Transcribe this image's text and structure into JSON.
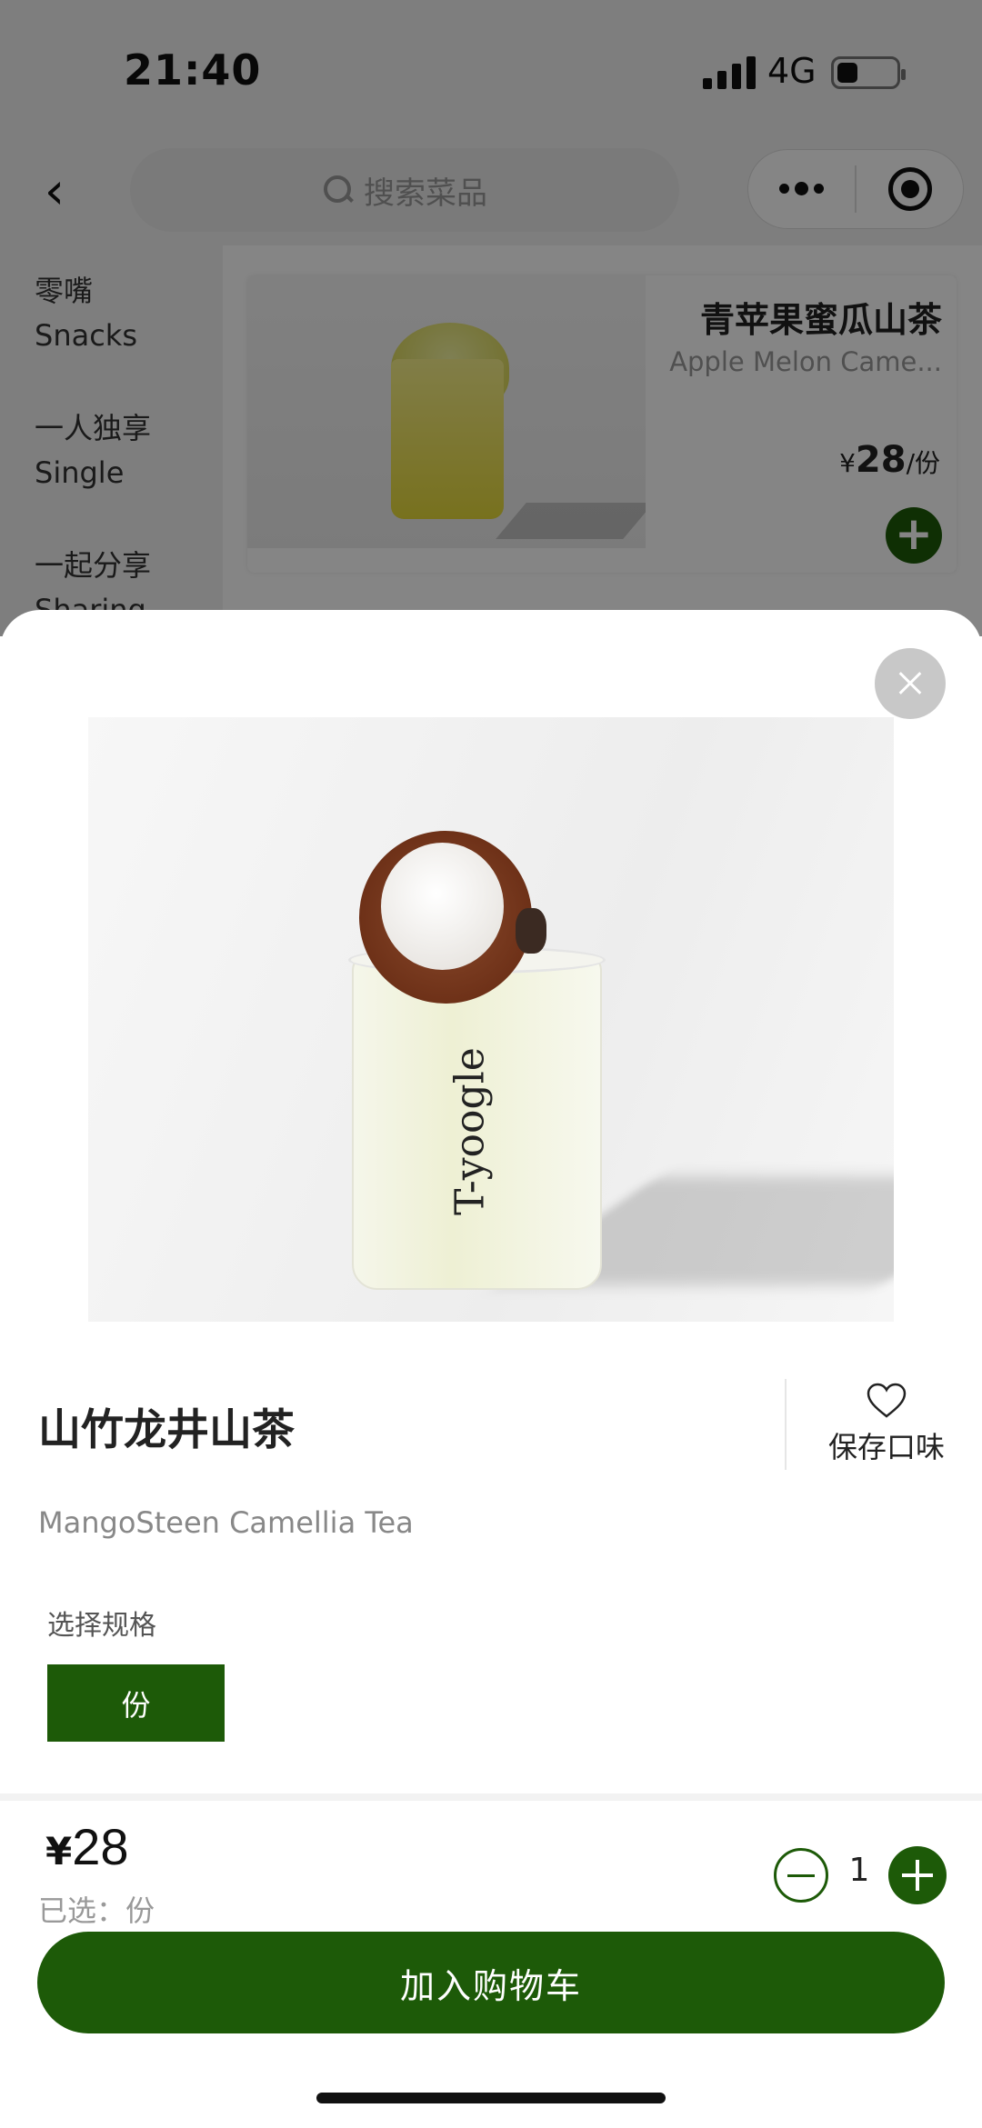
{
  "status_bar": {
    "time": "21:40",
    "network": "4G"
  },
  "nav": {
    "search_placeholder": "搜索菜品"
  },
  "side_menu": [
    {
      "cn": "零嘴",
      "en": "Snacks"
    },
    {
      "cn": "一人独享",
      "en": "Single"
    },
    {
      "cn": "一起分享",
      "en": "Sharing"
    }
  ],
  "bg_product": {
    "title": "青苹果蜜瓜山茶",
    "subtitle": "Apple Melon Came...",
    "currency": "¥",
    "price": "28",
    "unit": "/份"
  },
  "modal": {
    "name": "山竹龙井山茶",
    "name_en": "MangoSteen Camellia Tea",
    "favorite_label": "保存口味",
    "spec_label": "选择规格",
    "spec_option": "份",
    "cup_logo": "T-yoogle",
    "currency": "¥",
    "price": "28",
    "selected_text": "已选：份",
    "quantity": "1",
    "add_to_cart": "加入购物车"
  },
  "colors": {
    "brand_green": "#1d5a08",
    "overlay": "rgba(0,0,0,0.48)"
  },
  "icons": [
    "back-icon",
    "search-icon",
    "more-icon",
    "target-icon",
    "close-icon",
    "heart-icon",
    "minus-icon",
    "plus-icon"
  ]
}
